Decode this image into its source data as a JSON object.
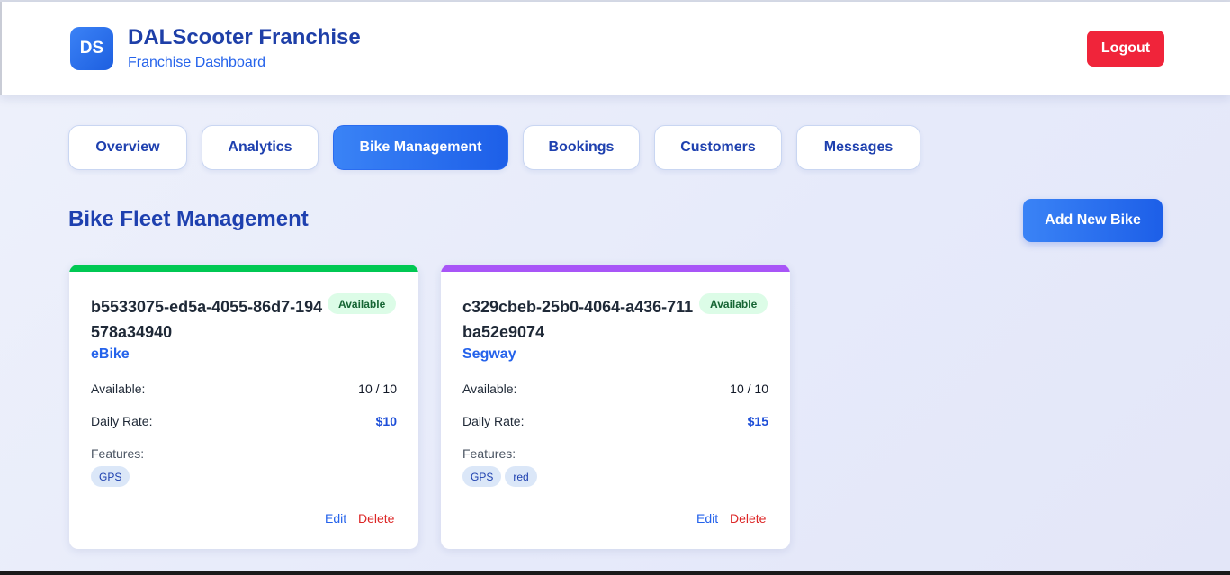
{
  "header": {
    "logo_text": "DS",
    "title": "DALScooter Franchise",
    "subtitle": "Franchise Dashboard",
    "logout_label": "Logout"
  },
  "tabs": [
    {
      "label": "Overview",
      "active": false
    },
    {
      "label": "Analytics",
      "active": false
    },
    {
      "label": "Bike Management",
      "active": true
    },
    {
      "label": "Bookings",
      "active": false
    },
    {
      "label": "Customers",
      "active": false
    },
    {
      "label": "Messages",
      "active": false
    }
  ],
  "section": {
    "title": "Bike Fleet Management",
    "add_button_label": "Add New Bike"
  },
  "bikes": [
    {
      "id": "b5533075-ed5a-4055-86d7-194578a34940",
      "status": "Available",
      "type": "eBike",
      "accent_color": "#00c853",
      "available_label": "Available:",
      "available_value": "10 / 10",
      "rate_label": "Daily Rate:",
      "rate_value": "$10",
      "features_label": "Features:",
      "features": [
        "GPS"
      ],
      "edit_label": "Edit",
      "delete_label": "Delete"
    },
    {
      "id": "c329cbeb-25b0-4064-a436-711ba52e9074",
      "status": "Available",
      "type": "Segway",
      "accent_color": "#a855f7",
      "available_label": "Available:",
      "available_value": "10 / 10",
      "rate_label": "Daily Rate:",
      "rate_value": "$15",
      "features_label": "Features:",
      "features": [
        "GPS",
        "red"
      ],
      "edit_label": "Edit",
      "delete_label": "Delete"
    }
  ],
  "colors": {
    "brand": "#1e40af",
    "accent": "#2563eb",
    "danger": "#f0243a",
    "status_available_bg": "#dcfce7"
  }
}
